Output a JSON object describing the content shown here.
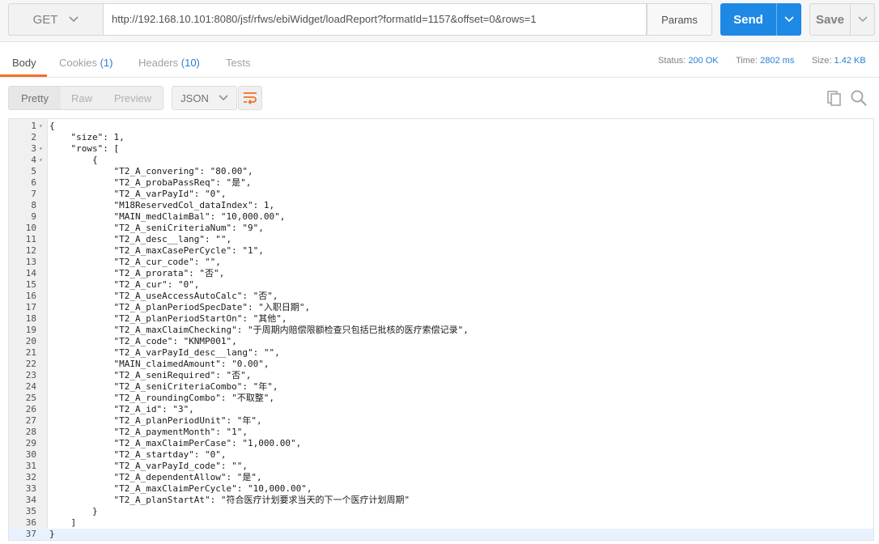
{
  "request": {
    "method": "GET",
    "url": "http://192.168.10.101:8080/jsf/rfws/ebiWidget/loadReport?formatId=1157&offset=0&rows=1",
    "params_label": "Params",
    "send_label": "Send",
    "save_label": "Save"
  },
  "response_tabs": {
    "body": "Body",
    "cookies": "Cookies",
    "cookies_count": "(1)",
    "headers": "Headers",
    "headers_count": "(10)",
    "tests": "Tests"
  },
  "status": {
    "status_label": "Status:",
    "status_value": "200 OK",
    "time_label": "Time:",
    "time_value": "2802 ms",
    "size_label": "Size:",
    "size_value": "1.42 KB"
  },
  "view": {
    "pretty": "Pretty",
    "raw": "Raw",
    "preview": "Preview",
    "format": "JSON"
  },
  "code_lines": [
    "{",
    "    \"size\": 1,",
    "    \"rows\": [",
    "        {",
    "            \"T2_A_convering\": \"80.00\",",
    "            \"T2_A_probaPassReq\": \"是\",",
    "            \"T2_A_varPayId\": \"0\",",
    "            \"M18ReservedCol_dataIndex\": 1,",
    "            \"MAIN_medClaimBal\": \"10,000.00\",",
    "            \"T2_A_seniCriteriaNum\": \"9\",",
    "            \"T2_A_desc__lang\": \"\",",
    "            \"T2_A_maxCasePerCycle\": \"1\",",
    "            \"T2_A_cur_code\": \"\",",
    "            \"T2_A_prorata\": \"否\",",
    "            \"T2_A_cur\": \"0\",",
    "            \"T2_A_useAccessAutoCalc\": \"否\",",
    "            \"T2_A_planPeriodSpecDate\": \"入职日期\",",
    "            \"T2_A_planPeriodStartOn\": \"其他\",",
    "            \"T2_A_maxClaimChecking\": \"于周期内赔偿限额检查只包括已批核的医疗索偿记录\",",
    "            \"T2_A_code\": \"KNMP001\",",
    "            \"T2_A_varPayId_desc__lang\": \"\",",
    "            \"MAIN_claimedAmount\": \"0.00\",",
    "            \"T2_A_seniRequired\": \"否\",",
    "            \"T2_A_seniCriteriaCombo\": \"年\",",
    "            \"T2_A_roundingCombo\": \"不取整\",",
    "            \"T2_A_id\": \"3\",",
    "            \"T2_A_planPeriodUnit\": \"年\",",
    "            \"T2_A_paymentMonth\": \"1\",",
    "            \"T2_A_maxClaimPerCase\": \"1,000.00\",",
    "            \"T2_A_startday\": \"0\",",
    "            \"T2_A_varPayId_code\": \"\",",
    "            \"T2_A_dependentAllow\": \"是\",",
    "            \"T2_A_maxClaimPerCycle\": \"10,000.00\",",
    "            \"T2_A_planStartAt\": \"符合医疗计划要求当天的下一个医疗计划周期\"",
    "        }",
    "    ]",
    "}"
  ],
  "foldable_lines": [
    1,
    3,
    4
  ],
  "current_line": 37,
  "colors": {
    "accent_blue": "#1e88e5",
    "tab_active_underline": "#f47023",
    "count_blue": "#2a7fd4"
  }
}
